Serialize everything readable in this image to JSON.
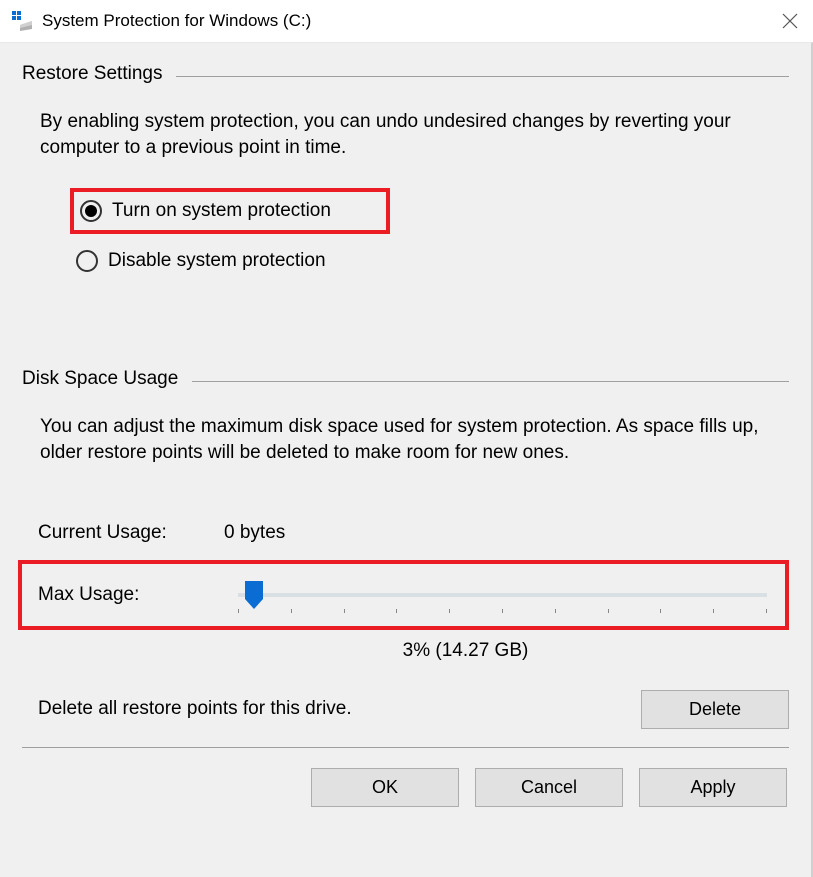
{
  "titlebar": {
    "title": "System Protection for Windows (C:)"
  },
  "restore": {
    "section_title": "Restore Settings",
    "desc": "By enabling system protection, you can undo undesired changes by reverting your computer to a previous point in time.",
    "opt_on": "Turn on system protection",
    "opt_off": "Disable system protection"
  },
  "disk": {
    "section_title": "Disk Space Usage",
    "desc": "You can adjust the maximum disk space used for system protection. As space fills up, older restore points will be deleted to make room for new ones.",
    "current_label": "Current Usage:",
    "current_value": "0 bytes",
    "max_label": "Max Usage:",
    "max_value": "3% (14.27 GB)",
    "delete_text": "Delete all restore points for this drive.",
    "delete_btn": "Delete"
  },
  "footer": {
    "ok": "OK",
    "cancel": "Cancel",
    "apply": "Apply"
  }
}
